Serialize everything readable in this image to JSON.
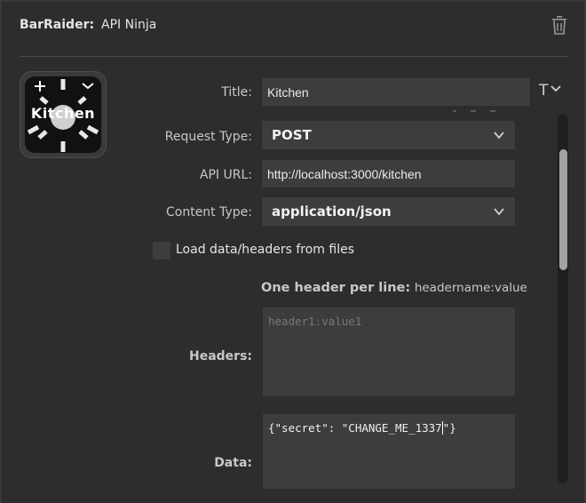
{
  "header": {
    "brand": "BarRaider:",
    "plugin_name": "API Ninja"
  },
  "key_preview": {
    "title": "Kitchen"
  },
  "form": {
    "title": {
      "label": "Title:",
      "value": "Kitchen"
    },
    "request_type": {
      "label": "Request Type:",
      "value": "POST"
    },
    "api_url": {
      "label": "API URL:",
      "value": "http://localhost:3000/kitchen"
    },
    "content_type": {
      "label": "Content Type:",
      "value": "application/json"
    },
    "load_from_files": {
      "label": "Load data/headers from files",
      "checked": false
    },
    "headers_hint": {
      "bold": "One header per line:",
      "small": "headername:value"
    },
    "headers": {
      "label": "Headers:",
      "placeholder": "header1:value1",
      "value": ""
    },
    "data": {
      "label": "Data:",
      "value_before_caret": "{\"secret\": \"CHANGE_ME_1337",
      "value_after_caret": "\"}"
    }
  },
  "icons": {
    "trash": "trash-icon",
    "title_tools": "text-format-icon",
    "dropdown": "chevron-down-icon"
  },
  "colors": {
    "background": "#2d2d2d",
    "field": "#3d3d3d",
    "text": "#e6e6e6"
  }
}
